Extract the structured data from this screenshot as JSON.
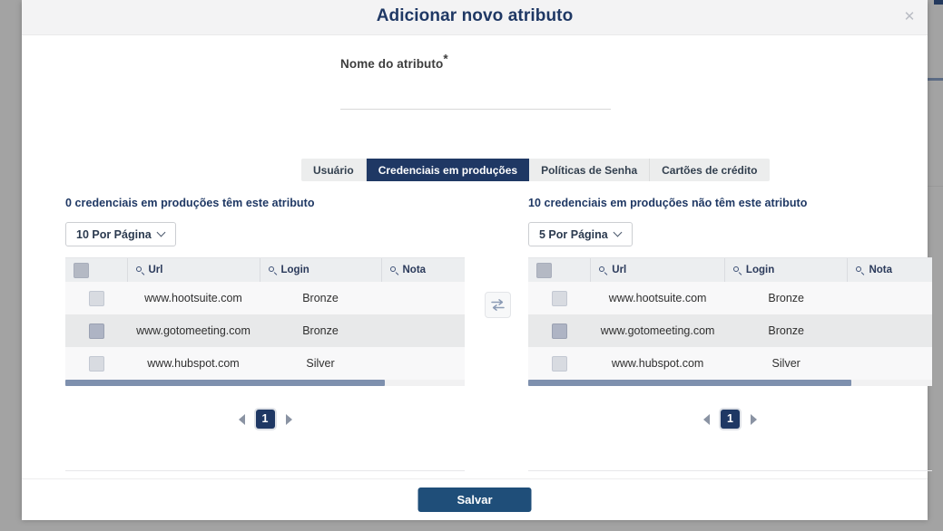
{
  "modal": {
    "title": "Adicionar novo atributo",
    "close_icon": "close-icon"
  },
  "form": {
    "label": "Nome do atributo",
    "required_mark": "*",
    "value": "",
    "placeholder": ""
  },
  "tabs": [
    {
      "label": "Usuário",
      "active": false
    },
    {
      "label": "Credenciais em produções",
      "active": true
    },
    {
      "label": "Políticas de Senha",
      "active": false
    },
    {
      "label": "Cartões de crédito",
      "active": false
    }
  ],
  "swap_button": {
    "icon": "swap-horizontal-icon"
  },
  "panels": {
    "left": {
      "caption": "0 credenciais em produções têm este atributo",
      "per_page": "10 Por Página",
      "columns": [
        "",
        "Url",
        "Login",
        "Nota"
      ],
      "rows": [
        {
          "checked": false,
          "url": "www.hootsuite.com",
          "login": "Bronze",
          "nota": ""
        },
        {
          "checked": true,
          "url": "www.gotomeeting.com",
          "login": "Bronze",
          "nota": ""
        },
        {
          "checked": false,
          "url": "www.hubspot.com",
          "login": "Silver",
          "nota": ""
        }
      ],
      "scroll_percent": 80,
      "pagination": {
        "prev": "◀",
        "page": "1",
        "next": "▶"
      }
    },
    "right": {
      "caption": "10 credenciais em produções não têm este atributo",
      "per_page": "5 Por Página",
      "columns": [
        "",
        "Url",
        "Login",
        "Nota"
      ],
      "rows": [
        {
          "checked": false,
          "url": "www.hootsuite.com",
          "login": "Bronze",
          "nota": ""
        },
        {
          "checked": true,
          "url": "www.gotomeeting.com",
          "login": "Bronze",
          "nota": ""
        },
        {
          "checked": false,
          "url": "www.hubspot.com",
          "login": "Silver",
          "nota": ""
        }
      ],
      "scroll_percent": 80,
      "pagination": {
        "prev": "◀",
        "page": "1",
        "next": "▶"
      }
    }
  },
  "footer": {
    "save_label": "Salvar"
  },
  "colors": {
    "accent_navy": "#1f3864",
    "save_blue": "#1f4e79",
    "header_gray": "#f3f3f4",
    "scroll_thumb": "#7e90ae"
  }
}
